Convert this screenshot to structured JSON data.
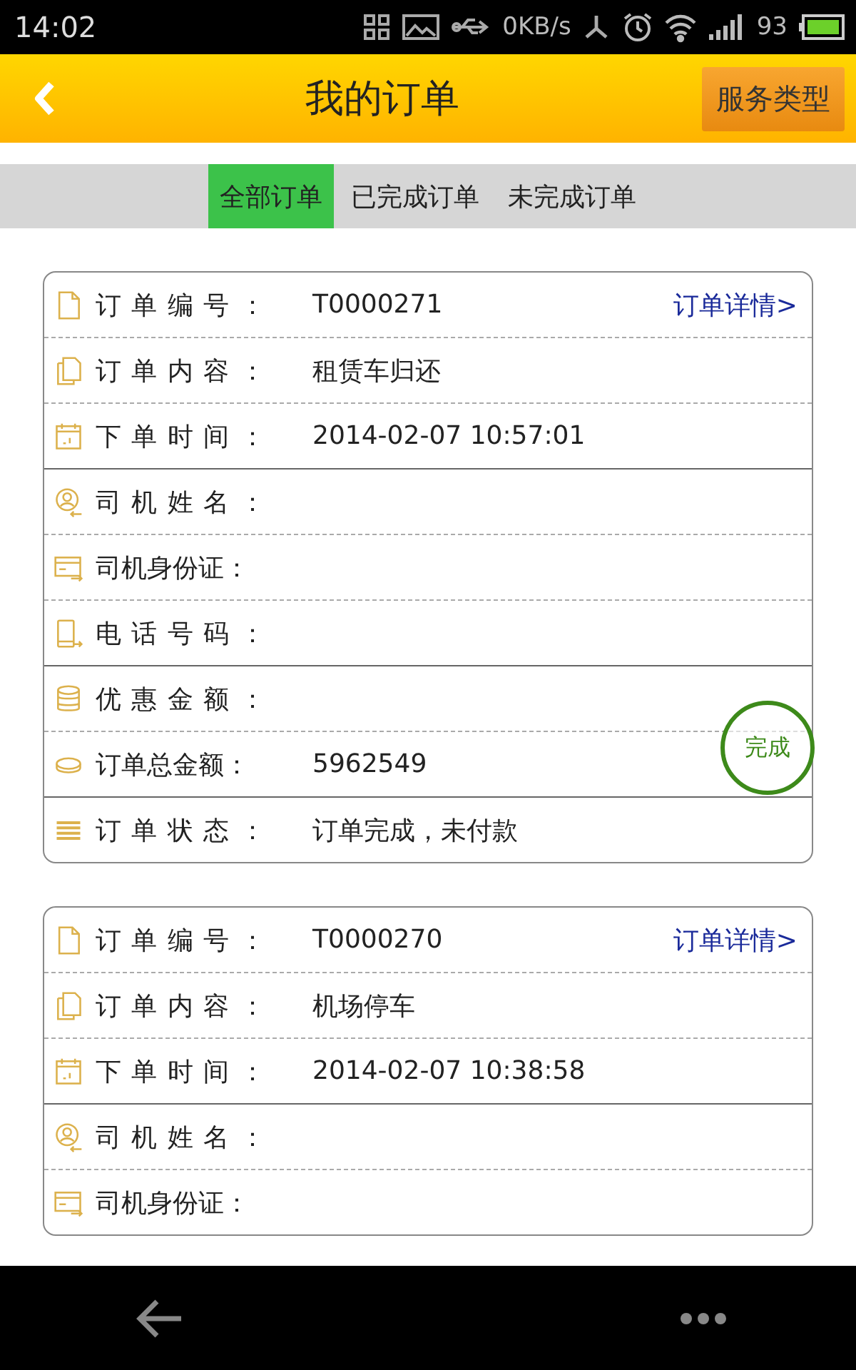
{
  "status_bar": {
    "time": "14:02",
    "speed": "0KB/s",
    "battery": "93"
  },
  "header": {
    "title": "我的订单",
    "action": "服务类型"
  },
  "tabs": [
    {
      "label": "全部订单",
      "selected": true
    },
    {
      "label": "已完成订单",
      "selected": false
    },
    {
      "label": "未完成订单",
      "selected": false
    }
  ],
  "orders": [
    {
      "detail_link": "订单详情>",
      "stamp": "完成",
      "sections": [
        [
          {
            "kind": "doc",
            "label": "订单编号：",
            "value": "T0000271"
          },
          {
            "kind": "docs",
            "label": "订单内容：",
            "value": "租赁车归还"
          },
          {
            "kind": "calendar",
            "label": "下单时间：",
            "value": "2014-02-07 10:57:01"
          }
        ],
        [
          {
            "kind": "person",
            "label": "司机姓名："
          },
          {
            "kind": "card",
            "label": "司机身份证："
          },
          {
            "kind": "phone",
            "label": "电话号码："
          }
        ],
        [
          {
            "kind": "coins",
            "label": "优惠金额："
          },
          {
            "kind": "coin",
            "label": "订单总金额：",
            "value": "5962549"
          }
        ],
        [
          {
            "kind": "list",
            "label": "订单状态：",
            "value": "订单完成，未付款"
          }
        ]
      ]
    },
    {
      "detail_link": "订单详情>",
      "sections": [
        [
          {
            "kind": "doc",
            "label": "订单编号：",
            "value": "T0000270"
          },
          {
            "kind": "docs",
            "label": "订单内容：",
            "value": "机场停车"
          },
          {
            "kind": "calendar",
            "label": "下单时间：",
            "value": "2014-02-07 10:38:58"
          }
        ],
        [
          {
            "kind": "person",
            "label": "司机姓名："
          },
          {
            "kind": "card",
            "label": "司机身份证："
          }
        ]
      ]
    }
  ]
}
